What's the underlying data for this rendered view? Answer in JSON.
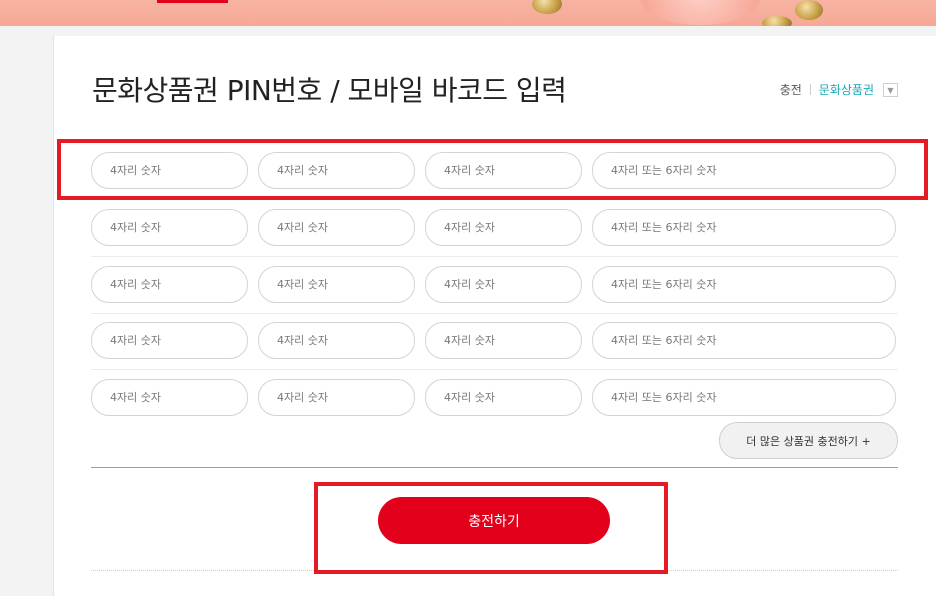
{
  "page": {
    "title": "문화상품권 PIN번호 / 모바일 바코드 입력"
  },
  "breadcrumb": {
    "parent": "충전",
    "current": "문화상품권",
    "dropdown_icon": "▼"
  },
  "pin_rows": [
    {
      "placeholders": [
        "4자리 숫자",
        "4자리 숫자",
        "4자리 숫자",
        "4자리 또는 6자리 숫자"
      ]
    },
    {
      "placeholders": [
        "4자리 숫자",
        "4자리 숫자",
        "4자리 숫자",
        "4자리 또는 6자리 숫자"
      ]
    },
    {
      "placeholders": [
        "4자리 숫자",
        "4자리 숫자",
        "4자리 숫자",
        "4자리 또는 6자리 숫자"
      ]
    },
    {
      "placeholders": [
        "4자리 숫자",
        "4자리 숫자",
        "4자리 숫자",
        "4자리 또는 6자리 숫자"
      ]
    },
    {
      "placeholders": [
        "4자리 숫자",
        "4자리 숫자",
        "4자리 숫자",
        "4자리 또는 6자리 숫자"
      ]
    }
  ],
  "buttons": {
    "more_label": "더 많은 상품권 충전하기 +",
    "charge_label": "충전하기"
  },
  "colors": {
    "accent_red": "#e3001b",
    "highlight_red": "#e51a24",
    "breadcrumb_current": "#16a9b5",
    "banner_pink": "#f6a895"
  }
}
